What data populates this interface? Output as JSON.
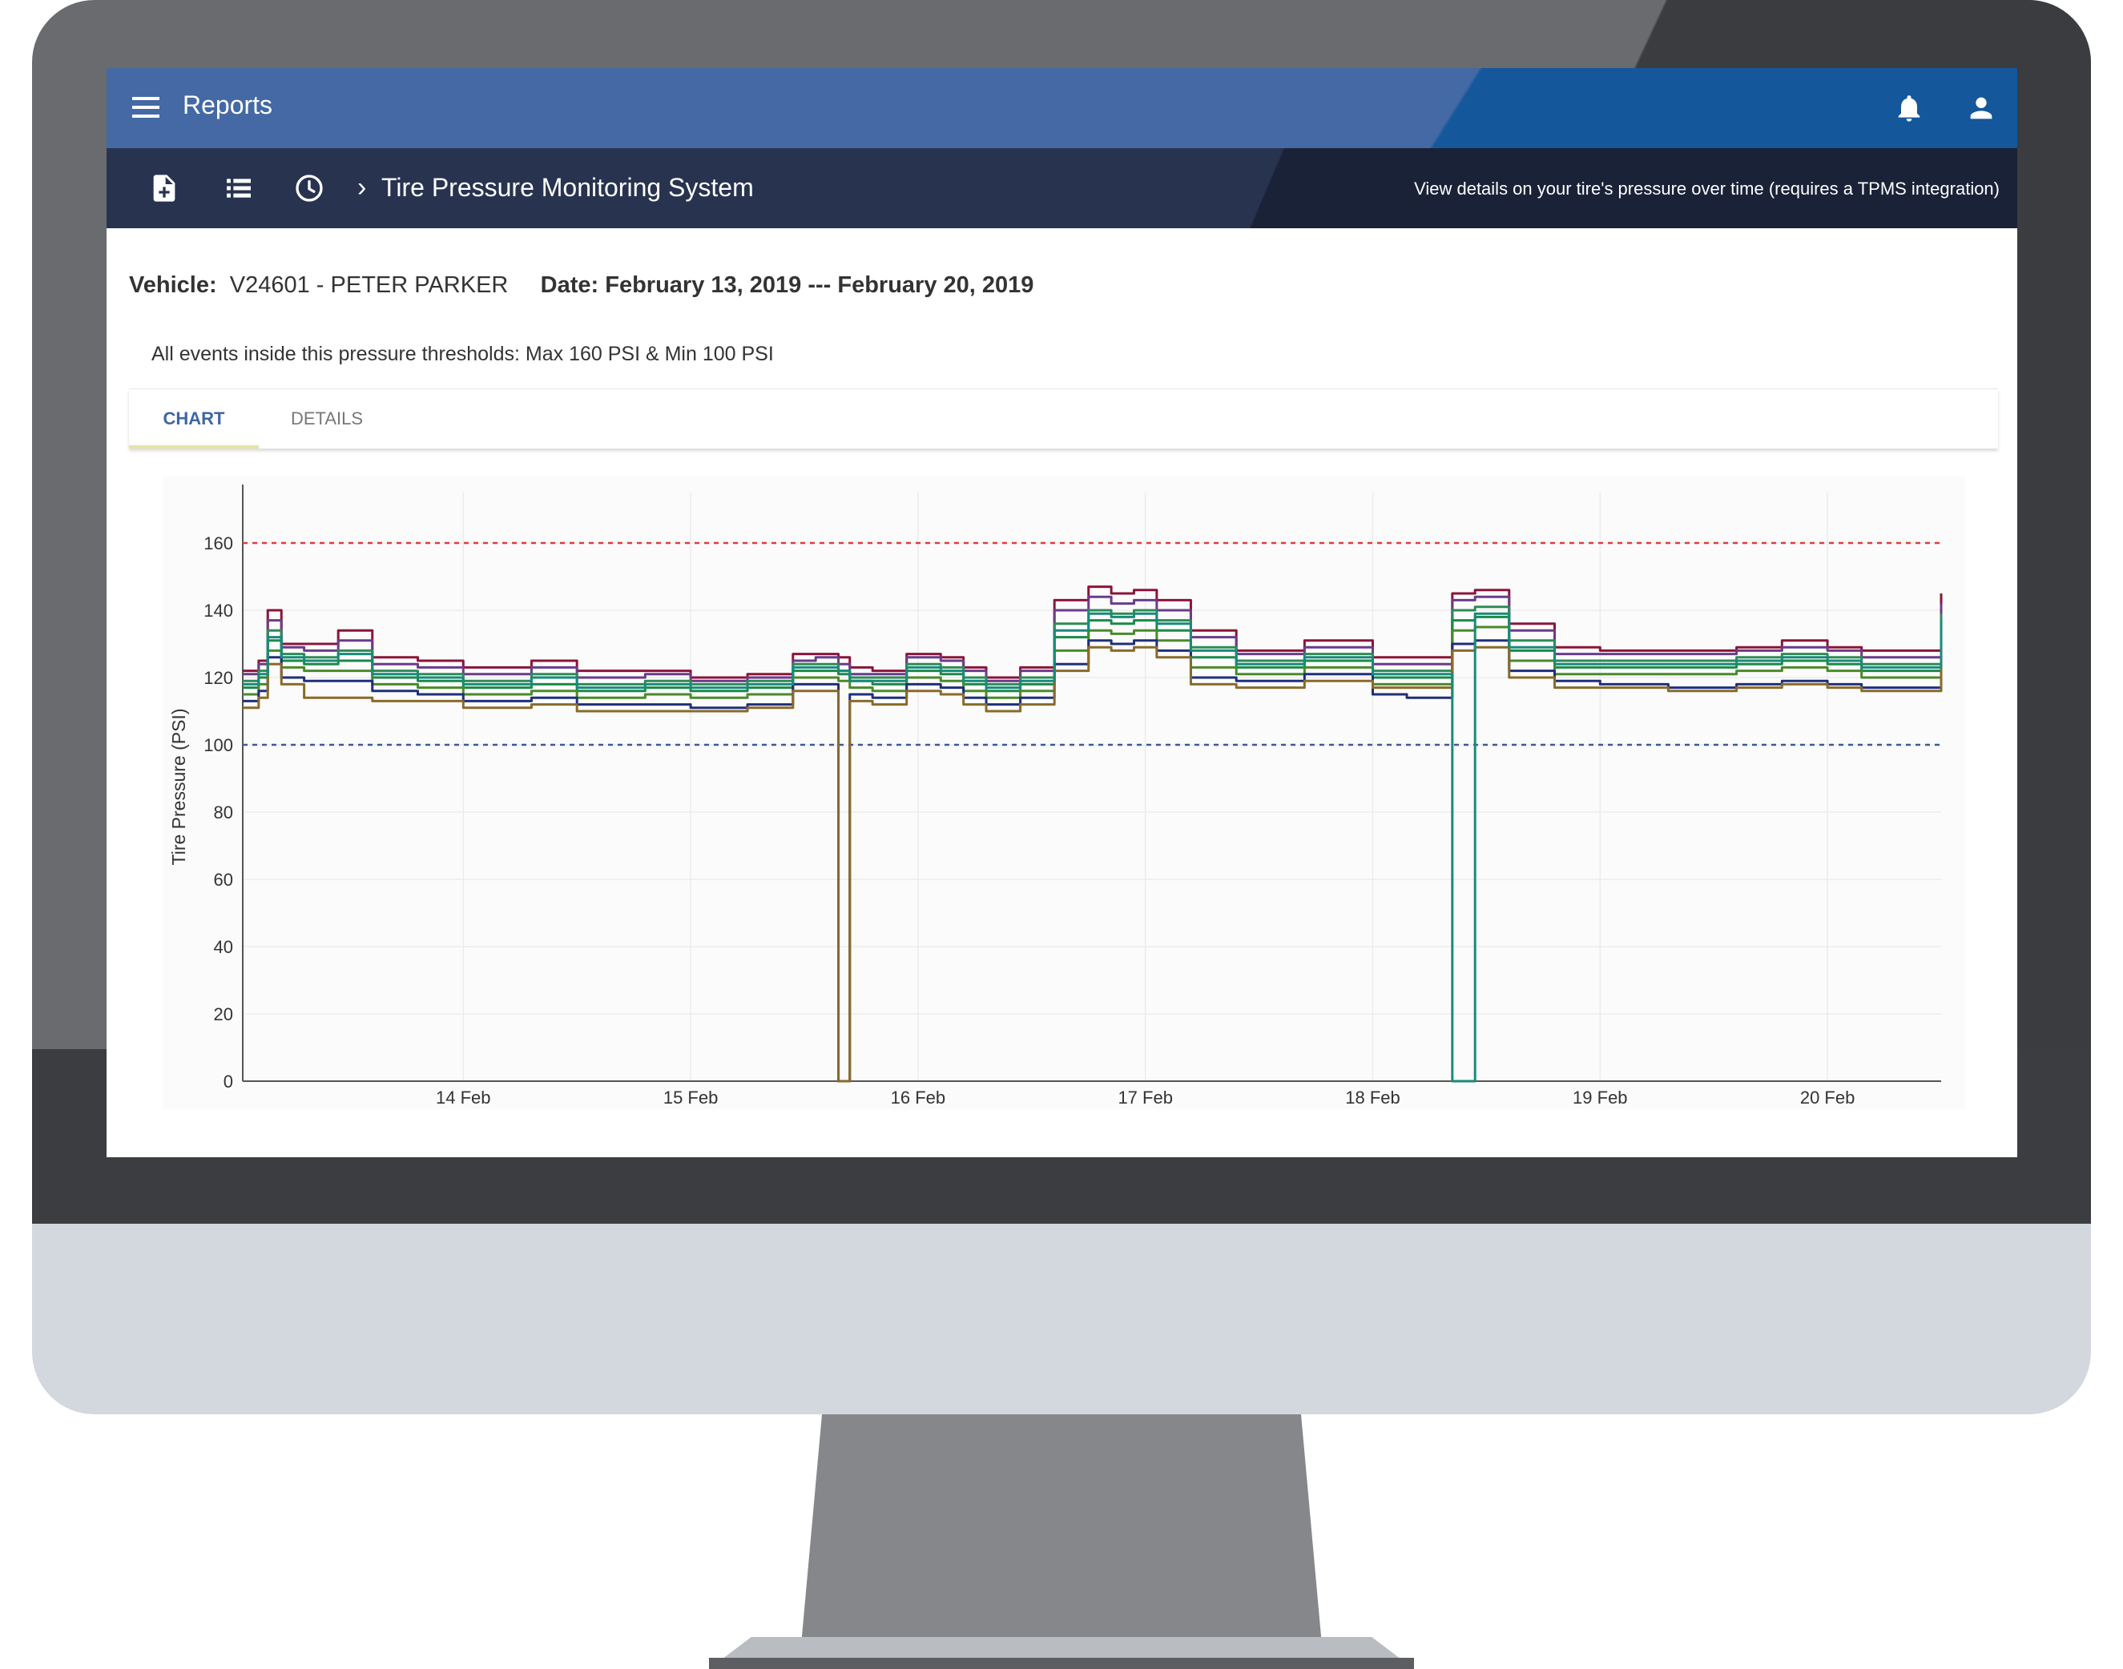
{
  "app": {
    "title": "Reports",
    "icons": {
      "menu": "menu-icon",
      "notifications": "bell-icon",
      "account": "user-icon",
      "new_report": "file-add-icon",
      "list": "list-icon",
      "history": "clock-icon"
    },
    "colors": {
      "topbar": "#4469a4",
      "topbar_accent": "#14579a",
      "subbar": "#283350",
      "tab_active": "#3e66a4"
    }
  },
  "breadcrumb": {
    "title": "Tire Pressure Monitoring System",
    "description": "View details on your tire's pressure over time (requires a TPMS integration)"
  },
  "report": {
    "vehicle_label": "Vehicle:",
    "vehicle_value": "V24601 - PETER PARKER",
    "date_label": "Date: February 13, 2019 --- February 20, 2019",
    "threshold_note": "All events inside this pressure thresholds: Max 160 PSI & Min 100 PSI"
  },
  "tabs": [
    {
      "label": "CHART",
      "active": true
    },
    {
      "label": "DETAILS",
      "active": false
    }
  ],
  "chart_data": {
    "type": "line",
    "xlabel": "",
    "ylabel": "Tire Pressure (PSI)",
    "ylim": [
      0,
      175
    ],
    "yticks": [
      0,
      20,
      40,
      60,
      80,
      100,
      120,
      140,
      160
    ],
    "xlim": [
      13.03,
      20.5
    ],
    "xticks": [
      {
        "value": 14,
        "label": "14 Feb"
      },
      {
        "value": 15,
        "label": "15 Feb"
      },
      {
        "value": 16,
        "label": "16 Feb"
      },
      {
        "value": 17,
        "label": "17 Feb"
      },
      {
        "value": 18,
        "label": "18 Feb"
      },
      {
        "value": 19,
        "label": "19 Feb"
      },
      {
        "value": 20,
        "label": "20 Feb"
      }
    ],
    "grid": true,
    "thresholds": [
      {
        "value": 160,
        "color": "#e03b3b"
      },
      {
        "value": 100,
        "color": "#3c5a9a"
      }
    ],
    "x": [
      13.03,
      13.1,
      13.14,
      13.2,
      13.3,
      13.45,
      13.6,
      13.8,
      14.0,
      14.3,
      14.5,
      14.8,
      15.0,
      15.25,
      15.45,
      15.55,
      15.65,
      15.7,
      15.8,
      15.95,
      16.1,
      16.2,
      16.3,
      16.45,
      16.6,
      16.75,
      16.85,
      16.95,
      17.05,
      17.2,
      17.4,
      17.7,
      18.0,
      18.15,
      18.3,
      18.35,
      18.45,
      18.6,
      18.8,
      19.0,
      19.3,
      19.6,
      19.8,
      20.0,
      20.15,
      20.25,
      20.35,
      20.5
    ],
    "series": [
      {
        "color": "#8a1538",
        "values": [
          122,
          125,
          140,
          130,
          130,
          134,
          126,
          125,
          123,
          125,
          122,
          122,
          120,
          121,
          127,
          127,
          126,
          123,
          122,
          127,
          126,
          123,
          120,
          123,
          143,
          147,
          145,
          146,
          143,
          134,
          128,
          131,
          126,
          126,
          126,
          145,
          146,
          136,
          129,
          128,
          128,
          129,
          131,
          129,
          128,
          128,
          128,
          145
        ]
      },
      {
        "color": "#6b3b8a",
        "values": [
          121,
          124,
          137,
          129,
          128,
          131,
          124,
          123,
          121,
          123,
          120,
          121,
          119,
          120,
          125,
          126,
          124,
          121,
          121,
          126,
          125,
          122,
          119,
          122,
          140,
          144,
          142,
          143,
          140,
          132,
          127,
          129,
          124,
          124,
          124,
          143,
          144,
          134,
          127,
          127,
          127,
          128,
          129,
          128,
          126,
          126,
          126,
          142
        ]
      },
      {
        "color": "#2e8b57",
        "values": [
          119,
          122,
          134,
          127,
          126,
          128,
          122,
          121,
          119,
          121,
          118,
          119,
          118,
          119,
          124,
          124,
          122,
          120,
          120,
          124,
          123,
          120,
          118,
          120,
          136,
          140,
          139,
          140,
          137,
          129,
          125,
          127,
          122,
          122,
          122,
          140,
          141,
          131,
          125,
          125,
          125,
          126,
          127,
          126,
          124,
          124,
          124,
          139
        ]
      },
      {
        "color": "#1a8a4a",
        "values": [
          117,
          120,
          131,
          125,
          124,
          125,
          120,
          119,
          117,
          118,
          116,
          117,
          116,
          117,
          122,
          122,
          121,
          119,
          118,
          122,
          121,
          118,
          116,
          118,
          132,
          137,
          136,
          137,
          134,
          126,
          123,
          125,
          120,
          120,
          120,
          137,
          138,
          128,
          123,
          123,
          123,
          124,
          125,
          124,
          122,
          122,
          122,
          136
        ]
      },
      {
        "color": "#4a8a2a",
        "values": [
          115,
          118,
          128,
          123,
          122,
          122,
          118,
          117,
          115,
          116,
          114,
          115,
          114,
          115,
          120,
          120,
          119,
          117,
          116,
          120,
          119,
          116,
          114,
          116,
          128,
          134,
          133,
          134,
          131,
          123,
          121,
          123,
          118,
          118,
          118,
          134,
          135,
          125,
          121,
          121,
          121,
          122,
          123,
          122,
          120,
          120,
          120,
          133
        ]
      },
      {
        "color": "#1f2f7a",
        "values": [
          113,
          116,
          126,
          120,
          119,
          119,
          116,
          115,
          113,
          114,
          112,
          112,
          111,
          112,
          118,
          118,
          0,
          115,
          114,
          118,
          117,
          114,
          112,
          114,
          124,
          131,
          130,
          131,
          128,
          120,
          119,
          121,
          115,
          114,
          114,
          130,
          131,
          122,
          119,
          118,
          117,
          118,
          119,
          118,
          117,
          117,
          117,
          130
        ]
      },
      {
        "color": "#8a6a2a",
        "values": [
          111,
          114,
          124,
          118,
          114,
          114,
          113,
          113,
          111,
          112,
          110,
          110,
          110,
          111,
          116,
          116,
          0,
          113,
          112,
          116,
          115,
          112,
          110,
          112,
          122,
          129,
          128,
          129,
          126,
          118,
          117,
          119,
          117,
          117,
          117,
          128,
          129,
          120,
          117,
          117,
          116,
          117,
          118,
          117,
          116,
          116,
          116,
          128
        ]
      },
      {
        "color": "#198a7a",
        "values": [
          118,
          121,
          132,
          126,
          125,
          127,
          121,
          120,
          118,
          120,
          117,
          118,
          117,
          118,
          123,
          123,
          122,
          119,
          119,
          123,
          122,
          119,
          117,
          119,
          134,
          139,
          138,
          139,
          136,
          128,
          124,
          126,
          121,
          121,
          121,
          0,
          139,
          129,
          124,
          124,
          124,
          125,
          126,
          125,
          123,
          123,
          123,
          137
        ]
      }
    ]
  }
}
